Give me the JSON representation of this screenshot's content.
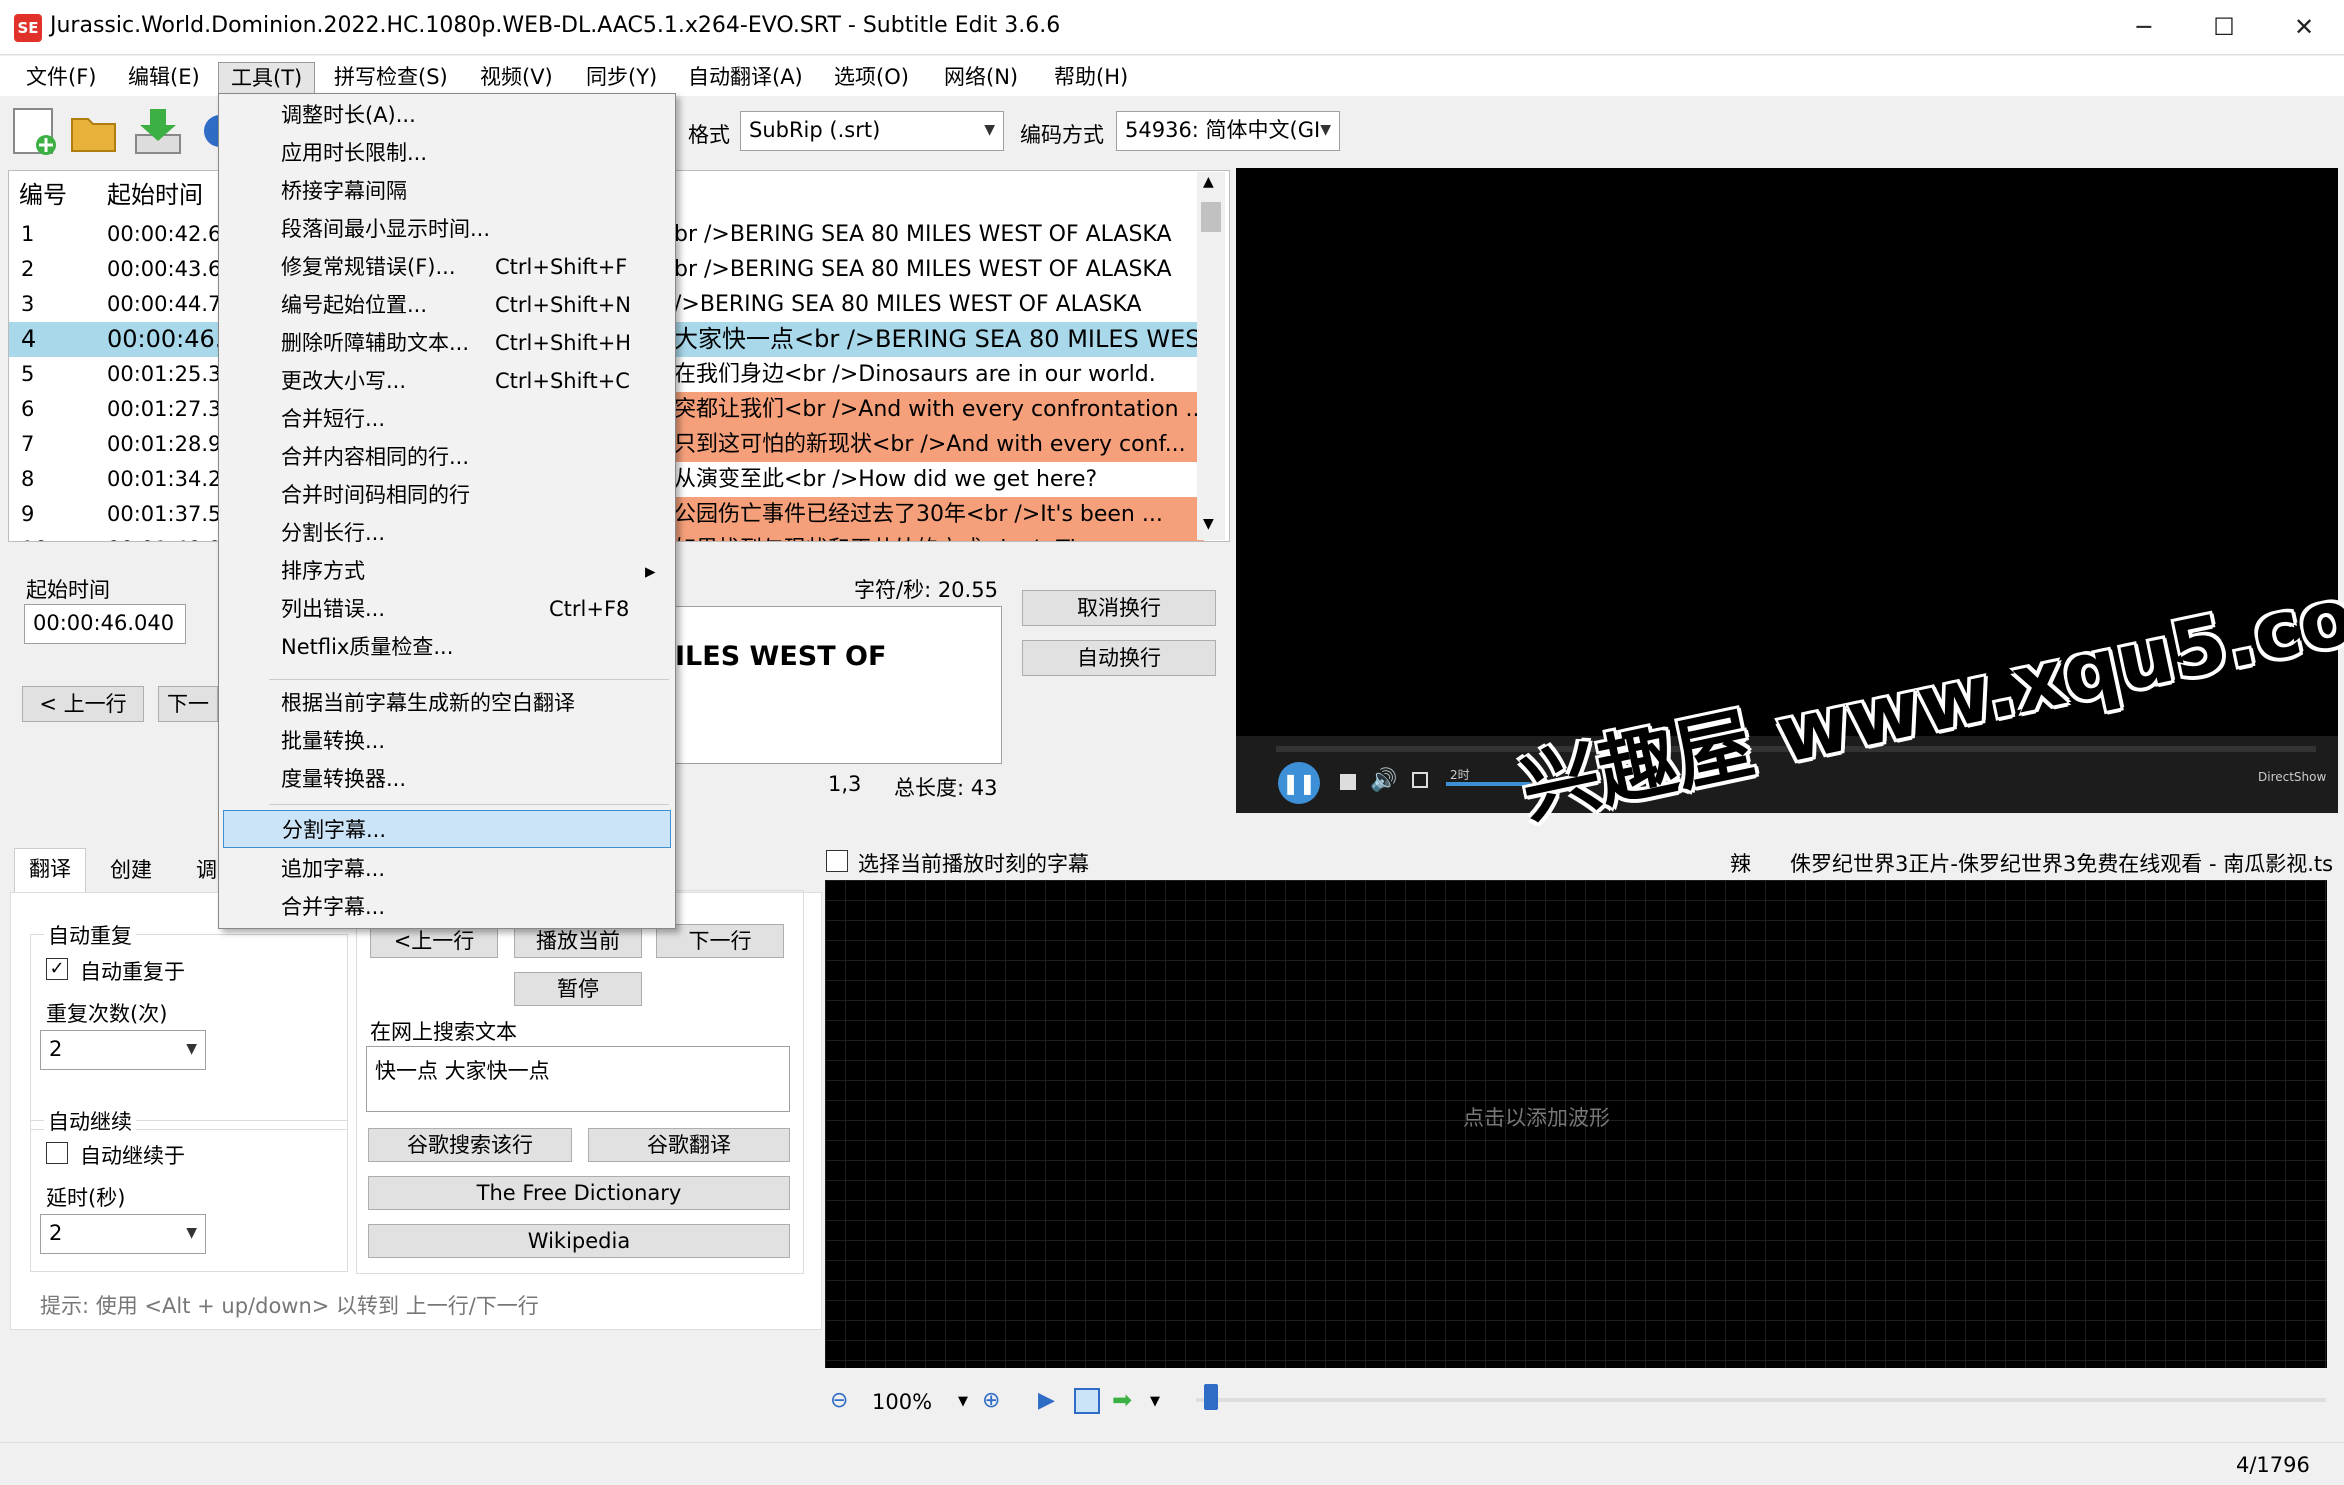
{
  "window": {
    "title": "Jurassic.World.Dominion.2022.HC.1080p.WEB-DL.AAC5.1.x264-EVO.SRT - Subtitle Edit 3.6.6",
    "app_icon_text": "SE",
    "minimize": "─",
    "maximize": "☐",
    "close": "✕"
  },
  "menubar": [
    "文件(F)",
    "编辑(E)",
    "工具(T)",
    "拼写检查(S)",
    "视频(V)",
    "同步(Y)",
    "自动翻译(A)",
    "选项(O)",
    "网络(N)",
    "帮助(H)"
  ],
  "toolbar": {
    "format_label": "格式",
    "format_value": "SubRip (.srt)",
    "encoding_label": "编码方式",
    "encoding_value": "54936: 简体中文(GI"
  },
  "grid": {
    "headers": {
      "num": "编号",
      "start": "起始时间"
    },
    "rows": [
      {
        "num": "1",
        "start": "00:00:42.6",
        "text": "br />BERING SEA 80 MILES WEST OF ALASKA"
      },
      {
        "num": "2",
        "start": "00:00:43.6",
        "text": "br />BERING SEA 80 MILES WEST OF ALASKA"
      },
      {
        "num": "3",
        "start": "00:00:44.7",
        "text": "/>BERING SEA 80 MILES WEST OF ALASKA"
      },
      {
        "num": "4",
        "start": "00:00:46.",
        "text": "大家快一点<br />BERING SEA 80 MILES WEST O"
      },
      {
        "num": "5",
        "start": "00:01:25.3",
        "text": "在我们身边<br />Dinosaurs are in our world."
      },
      {
        "num": "6",
        "start": "00:01:27.3",
        "text": "突都让我们<br />And with every confrontation ..."
      },
      {
        "num": "7",
        "start": "00:01:28.9",
        "text": "只到这可怕的新现状<br />And with every conf..."
      },
      {
        "num": "8",
        "start": "00:01:34.2",
        "text": "从演变至此<br />How did we get here?"
      },
      {
        "num": "9",
        "start": "00:01:37.5",
        "text": "公园伤亡事件已经过去了30年<br />It's been ..."
      },
      {
        "num": "10",
        "start": "00:01:40.0",
        "text": "如果找到与现状和平共处的方式<br />Th..."
      }
    ]
  },
  "edit": {
    "start_label": "起始时间",
    "start_value": "00:00:46.040",
    "prev_btn": "< 上一行",
    "next_btn": "下一",
    "cps": "字符/秒: 20.55",
    "textbox_text": "ILES WEST OF",
    "line_info": "1,3",
    "total_length": "总长度: 43",
    "cancel_wrap": "取消换行",
    "auto_wrap": "自动换行"
  },
  "video": {
    "time_label": "2时",
    "renderer": "DirectShow"
  },
  "lower": {
    "tabs": [
      "翻译",
      "创建",
      "调"
    ],
    "auto_repeat_group": "自动重复",
    "auto_repeat_check": "自动重复于",
    "repeat_count_label": "重复次数(次)",
    "repeat_count_value": "2",
    "auto_continue_group": "自动继续",
    "auto_continue_check": "自动继续于",
    "delay_label": "延时(秒)",
    "delay_value": "2",
    "prev_line": "<上一行",
    "play_current": "播放当前",
    "next_line": "下一行",
    "pause": "暂停",
    "search_label": "在网上搜索文本",
    "search_text": "快一点 大家快一点",
    "google_search": "谷歌搜索该行",
    "google_translate": "谷歌翻译",
    "free_dictionary": "The Free Dictionary",
    "wikipedia": "Wikipedia",
    "hint": "提示: 使用 <Alt + up/down> 以转到 上一行/下一行"
  },
  "waveform": {
    "select_current_check": "选择当前播放时刻的字幕",
    "video_file": "侏罗纪世界3正片-侏罗纪世界3免费在线观看 - 南瓜影视.ts",
    "video_file_prefix": "辣",
    "placeholder": "点击以添加波形",
    "zoom": "100%"
  },
  "status": {
    "position": "4/1796"
  },
  "tools_menu": {
    "items": [
      {
        "label": "调整时长(A)...",
        "shortcut": ""
      },
      {
        "label": "应用时长限制...",
        "shortcut": ""
      },
      {
        "label": "桥接字幕间隔",
        "shortcut": ""
      },
      {
        "label": "段落间最小显示时间...",
        "shortcut": ""
      },
      {
        "label": "修复常规错误(F)...",
        "shortcut": "Ctrl+Shift+F"
      },
      {
        "label": "编号起始位置...",
        "shortcut": "Ctrl+Shift+N"
      },
      {
        "label": "删除听障辅助文本...",
        "shortcut": "Ctrl+Shift+H"
      },
      {
        "label": "更改大小写...",
        "shortcut": "Ctrl+Shift+C"
      },
      {
        "label": "合并短行...",
        "shortcut": ""
      },
      {
        "label": "合并内容相同的行...",
        "shortcut": ""
      },
      {
        "label": "合并时间码相同的行",
        "shortcut": ""
      },
      {
        "label": "分割长行...",
        "shortcut": ""
      },
      {
        "label": "排序方式",
        "shortcut": ""
      },
      {
        "label": "列出错误...",
        "shortcut": "Ctrl+F8"
      },
      {
        "label": "Netflix质量检查...",
        "shortcut": ""
      },
      {
        "label": "根据当前字幕生成新的空白翻译",
        "shortcut": ""
      },
      {
        "label": "批量转换...",
        "shortcut": ""
      },
      {
        "label": "度量转换器...",
        "shortcut": ""
      },
      {
        "label": "分割字幕...",
        "shortcut": ""
      },
      {
        "label": "追加字幕...",
        "shortcut": ""
      },
      {
        "label": "合并字幕...",
        "shortcut": ""
      }
    ],
    "submenu_arrow": "▸"
  },
  "watermark": "兴趣屋 www.xqu5.com",
  "colors": {
    "selected_row": "#a8d8ea",
    "error_row": "#f5a07a",
    "menu_highlight": "#cce4f7"
  }
}
